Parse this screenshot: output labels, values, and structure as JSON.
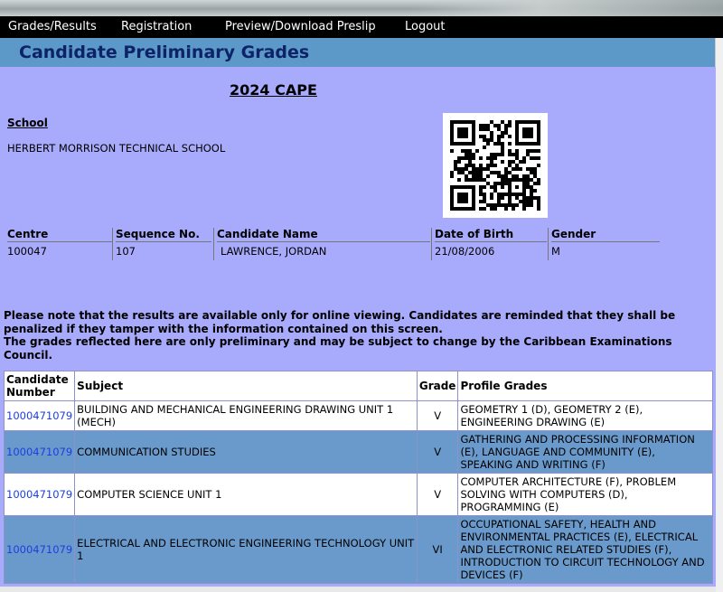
{
  "nav": {
    "items": [
      "Grades/Results",
      "Registration",
      "Preview/Download Preslip",
      "Logout"
    ]
  },
  "page": {
    "title": "Candidate Preliminary Grades",
    "exam_year": "2024 CAPE"
  },
  "school": {
    "label": "School",
    "name": "HERBERT MORRISON TECHNICAL SCHOOL"
  },
  "candidate_info": {
    "labels": {
      "centre": "Centre",
      "sequence": "Sequence No.",
      "name": "Candidate Name",
      "dob": "Date of Birth",
      "gender": "Gender"
    },
    "values": {
      "centre": "100047",
      "sequence": "107",
      "name": "LAWRENCE, JORDAN",
      "dob": "21/08/2006",
      "gender": "M"
    }
  },
  "notice": {
    "line1": "Please note that the results are available only for online viewing. Candidates are reminded that they shall be penalized if they tamper with the information contained on this screen.",
    "line2": "The grades reflected here are only preliminary and may be subject to change by the Caribbean Examinations Council."
  },
  "grades_table": {
    "headers": [
      "Candidate Number",
      "Subject",
      "Grade",
      "Profile Grades"
    ],
    "rows": [
      {
        "candidate": "1000471079",
        "subject": "BUILDING AND MECHANICAL ENGINEERING DRAWING UNIT 1 (MECH)",
        "grade": "V",
        "profile": "GEOMETRY 1 (D), GEOMETRY 2 (E), ENGINEERING DRAWING (E)"
      },
      {
        "candidate": "1000471079",
        "subject": "COMMUNICATION STUDIES",
        "grade": "V",
        "profile": "GATHERING AND PROCESSING INFORMATION (E), LANGUAGE AND COMMUNITY (E), SPEAKING AND WRITING (F)"
      },
      {
        "candidate": "1000471079",
        "subject": "COMPUTER SCIENCE UNIT 1",
        "grade": "V",
        "profile": "COMPUTER ARCHITECTURE (F), PROBLEM SOLVING WITH COMPUTERS (D), PROGRAMMING (E)"
      },
      {
        "candidate": "1000471079",
        "subject": "ELECTRICAL AND ELECTRONIC ENGINEERING TECHNOLOGY UNIT 1",
        "grade": "VI",
        "profile": "OCCUPATIONAL SAFETY, HEALTH AND ENVIRONMENTAL PRACTICES (E), ELECTRICAL AND ELECTRONIC RELATED STUDIES (F), INTRODUCTION TO CIRCUIT TECHNOLOGY AND DEVICES (F)"
      }
    ]
  },
  "colors": {
    "nav_bg": "#000000",
    "header_bg": "#5c98c8",
    "header_text": "#0c2467",
    "content_bg": "#a8aafc",
    "row_alt_bg": "#6a9acb",
    "link": "#1c3fe0"
  }
}
